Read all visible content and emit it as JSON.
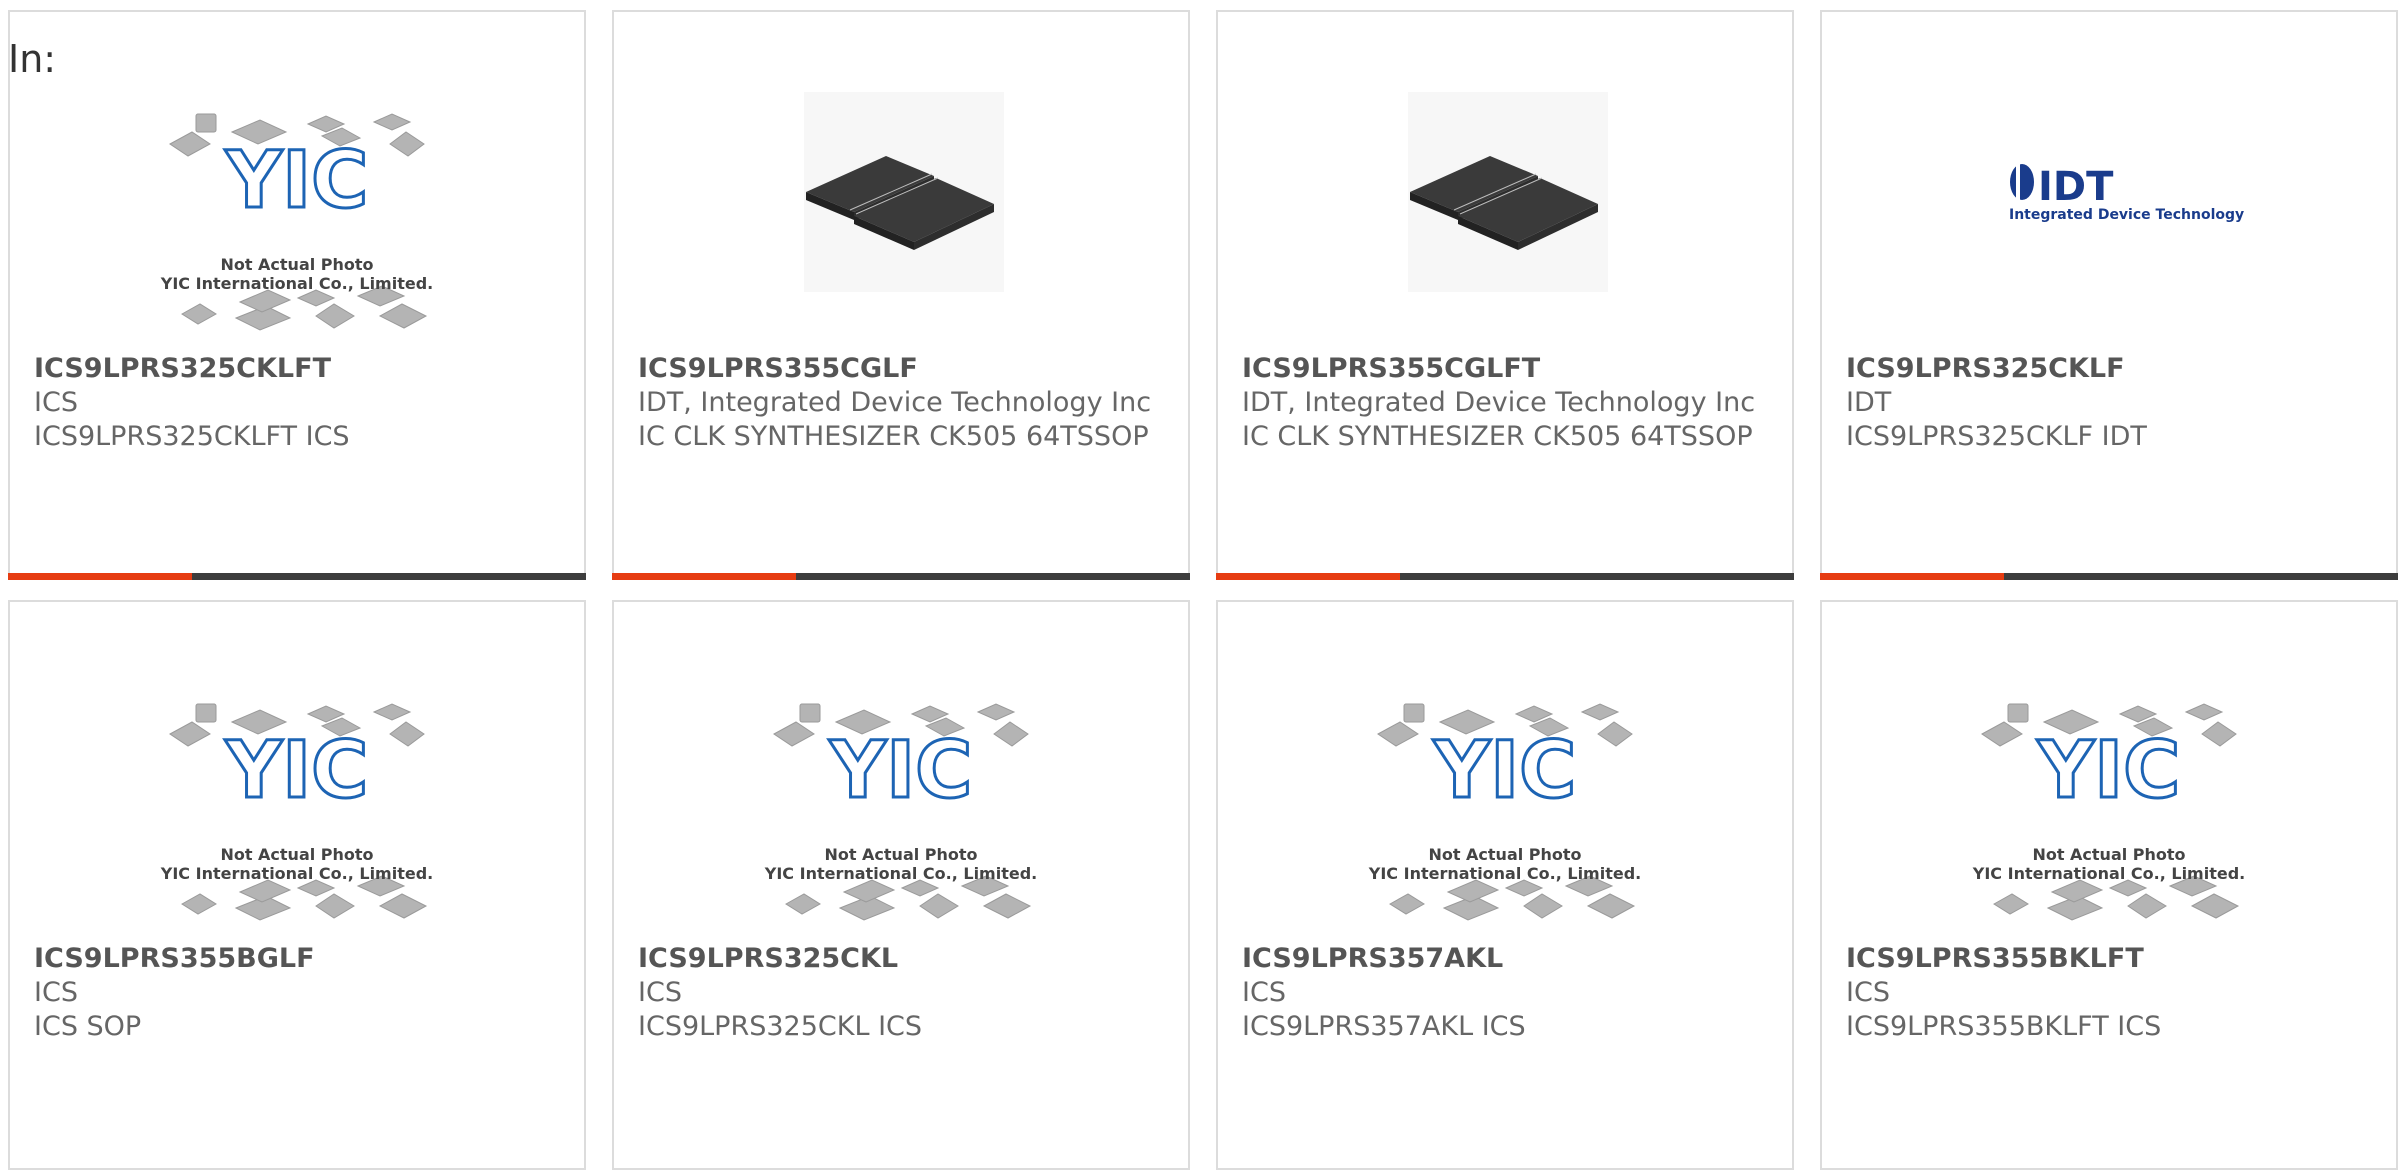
{
  "header": {
    "label": "In:"
  },
  "colors": {
    "accent": "#e63c12",
    "bar": "#3d3d3d",
    "yic_blue": "#1d64b4",
    "idt_blue": "#1a3c8c"
  },
  "products": [
    {
      "part_number": "ICS9LPRS325CKLFT",
      "manufacturer": "ICS",
      "description": "ICS9LPRS325CKLFT ICS",
      "image": "yic-not-actual-photo",
      "image_text": "Not Actual Photo",
      "image_subtext": "YIC International Co., Limited."
    },
    {
      "part_number": "ICS9LPRS355CGLF",
      "manufacturer": "IDT, Integrated Device Technology Inc",
      "description": "IC CLK SYNTHESIZER CK505 64TSSOP",
      "image": "tssop-chip-photo"
    },
    {
      "part_number": "ICS9LPRS355CGLFT",
      "manufacturer": "IDT, Integrated Device Technology Inc",
      "description": "IC CLK SYNTHESIZER CK505 64TSSOP",
      "image": "tssop-chip-photo"
    },
    {
      "part_number": "ICS9LPRS325CKLF",
      "manufacturer": "IDT",
      "description": "ICS9LPRS325CKLF IDT",
      "image": "idt-logo",
      "logo_text": "IDT",
      "logo_subtext": "Integrated Device Technology"
    },
    {
      "part_number": "ICS9LPRS355BGLF",
      "manufacturer": "ICS",
      "description": "ICS SOP",
      "image": "yic-not-actual-photo",
      "image_text": "Not Actual Photo",
      "image_subtext": "YIC International Co., Limited."
    },
    {
      "part_number": "ICS9LPRS325CKL",
      "manufacturer": "ICS",
      "description": "ICS9LPRS325CKL ICS",
      "image": "yic-not-actual-photo",
      "image_text": "Not Actual Photo",
      "image_subtext": "YIC International Co., Limited."
    },
    {
      "part_number": "ICS9LPRS357AKL",
      "manufacturer": "ICS",
      "description": "ICS9LPRS357AKL ICS",
      "image": "yic-not-actual-photo",
      "image_text": "Not Actual Photo",
      "image_subtext": "YIC International Co., Limited."
    },
    {
      "part_number": "ICS9LPRS355BKLFT",
      "manufacturer": "ICS",
      "description": "ICS9LPRS355BKLFT ICS",
      "image": "yic-not-actual-photo",
      "image_text": "Not Actual Photo",
      "image_subtext": "YIC International Co., Limited."
    }
  ]
}
